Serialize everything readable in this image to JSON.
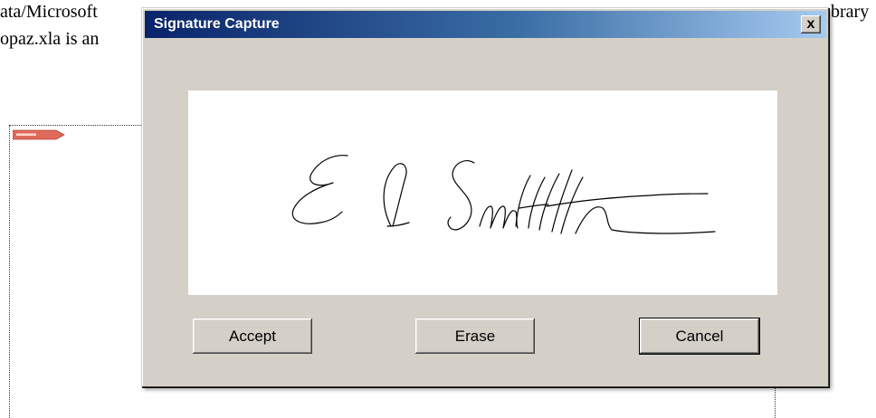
{
  "background": {
    "line1": "ata/Microsoft",
    "line2": "opaz.xla is an",
    "line1_right": "brary"
  },
  "dialog": {
    "title": "Signature Capture",
    "close_glyph": "x",
    "accept_label": "Accept",
    "erase_label": "Erase",
    "cancel_label": "Cancel"
  },
  "colors": {
    "dialog_face": "#d4d0c8",
    "titlebar_start": "#0a246a",
    "titlebar_end": "#a6caf0",
    "tag_red": "#e06a5a"
  }
}
